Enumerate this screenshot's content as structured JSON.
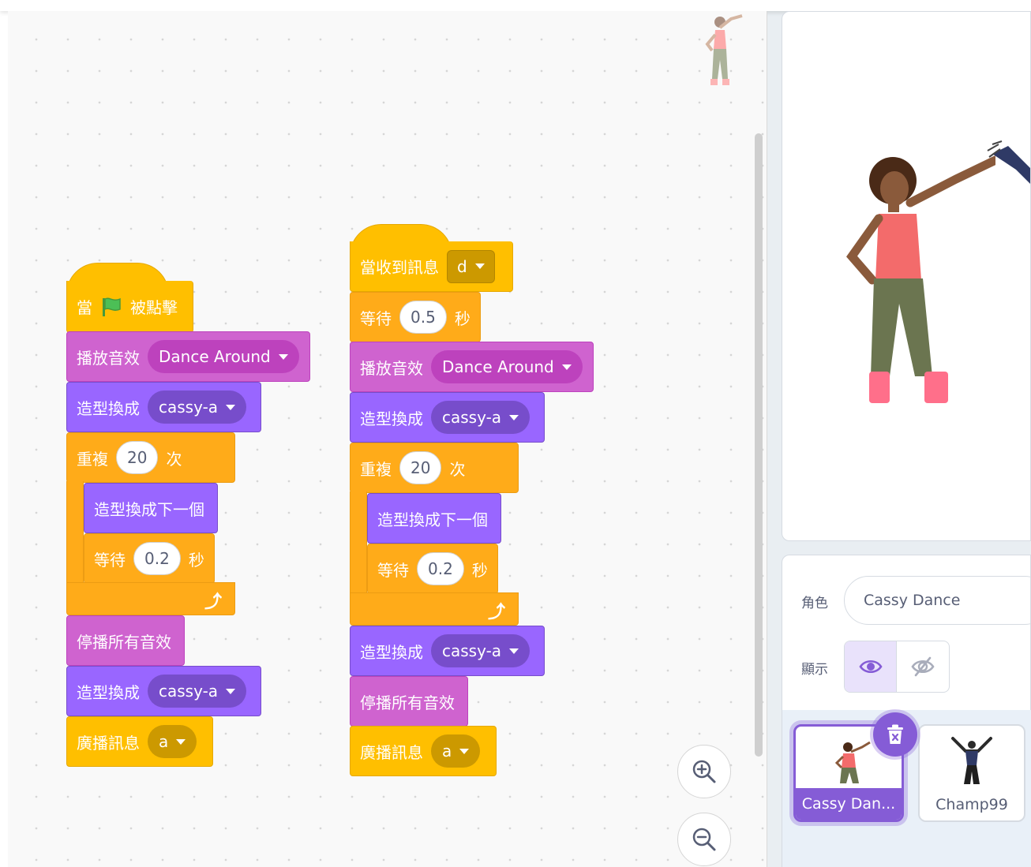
{
  "script1": {
    "hat": {
      "text1": "當",
      "text2": "被點擊"
    },
    "play_sound": {
      "label": "播放音效",
      "sound": "Dance Around"
    },
    "switch_costume_1": {
      "label": "造型換成",
      "costume": "cassy-a"
    },
    "repeat": {
      "label": "重複",
      "count": "20",
      "unit": "次"
    },
    "next_costume": {
      "label": "造型換成下一個"
    },
    "wait": {
      "label": "等待",
      "seconds": "0.2",
      "unit": "秒"
    },
    "stop_sounds": {
      "label": "停播所有音效"
    },
    "switch_costume_2": {
      "label": "造型換成",
      "costume": "cassy-a"
    },
    "broadcast": {
      "label": "廣播訊息",
      "message": "a"
    }
  },
  "script2": {
    "hat": {
      "label": "當收到訊息",
      "message": "d"
    },
    "wait_first": {
      "label": "等待",
      "seconds": "0.5",
      "unit": "秒"
    },
    "play_sound": {
      "label": "播放音效",
      "sound": "Dance Around"
    },
    "switch_costume_1": {
      "label": "造型換成",
      "costume": "cassy-a"
    },
    "repeat": {
      "label": "重複",
      "count": "20",
      "unit": "次"
    },
    "next_costume": {
      "label": "造型換成下一個"
    },
    "wait": {
      "label": "等待",
      "seconds": "0.2",
      "unit": "秒"
    },
    "switch_costume_2": {
      "label": "造型換成",
      "costume": "cassy-a"
    },
    "stop_sounds": {
      "label": "停播所有音效"
    },
    "broadcast": {
      "label": "廣播訊息",
      "message": "a"
    }
  },
  "sprite_info": {
    "sprite_label": "角色",
    "sprite_name": "Cassy Dance",
    "show_label": "顯示"
  },
  "sprites": [
    {
      "name": "Cassy Dan...",
      "selected": true
    },
    {
      "name": "Champ99",
      "selected": false
    }
  ],
  "colors": {
    "events": "#ffbf00",
    "sound": "#cf63cf",
    "looks": "#9966ff",
    "control": "#ffab19",
    "accent": "#855cd6"
  }
}
